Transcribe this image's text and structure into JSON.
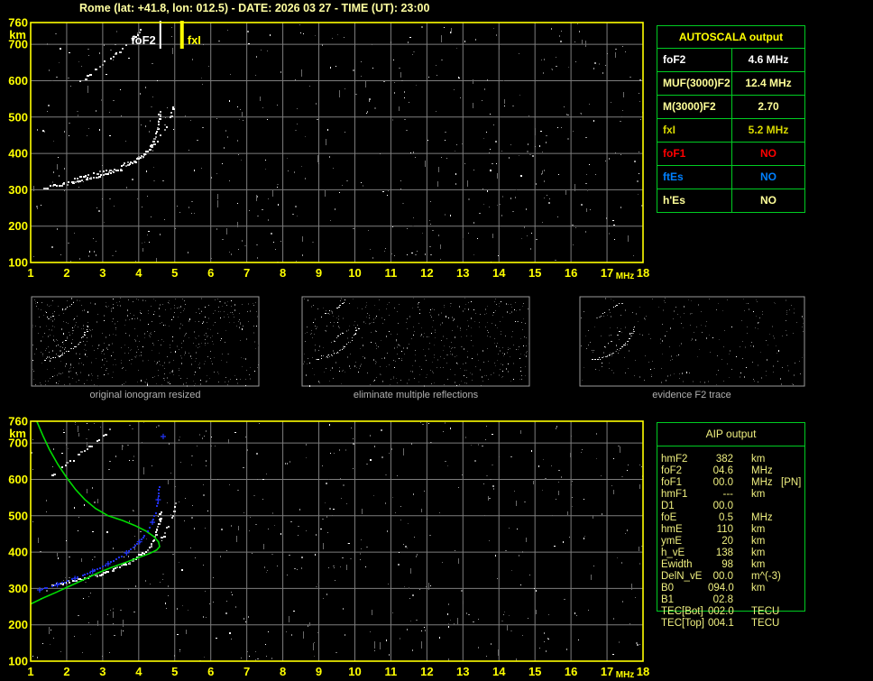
{
  "title": "Rome (lat: +41.8, lon: 012.5) - DATE: 2026 03 27 - TIME (UT): 23:00",
  "colors": {
    "accent_yellow": "#ffff00",
    "title_yellow": "#ffffa0",
    "pale_yellow": "#ffff99",
    "dark_yellow": "#d8d800",
    "white": "#ffffff",
    "red": "#ff0000",
    "blue": "#0080ff",
    "green_border": "#00cc22",
    "grid_gray": "#7d7d7d",
    "caption_gray": "#b0b0b0",
    "profile_green": "#00dd00",
    "trace_blue": "#2030e8"
  },
  "axes": {
    "x_range": [
      1,
      18
    ],
    "x_ticks": [
      1,
      2,
      3,
      4,
      5,
      6,
      7,
      8,
      9,
      10,
      11,
      12,
      13,
      14,
      15,
      16,
      17,
      18
    ],
    "x_unit": "MHz",
    "y_range": [
      100,
      760
    ],
    "y_ticks": [
      760,
      700,
      600,
      500,
      400,
      300,
      200,
      100
    ],
    "y_unit": "km",
    "grid": true
  },
  "chart_data": [
    {
      "type": "scatter",
      "name": "ionogram-autoscaled",
      "title": "",
      "xlabel": "MHz",
      "ylabel": "km",
      "xlim": [
        1,
        18
      ],
      "ylim": [
        100,
        760
      ],
      "legend": false,
      "markers": [
        {
          "label": "foF2",
          "x": 4.6,
          "color": "#ffffff",
          "width": 2,
          "side": "left"
        },
        {
          "label": "fxI",
          "x": 5.2,
          "color": "#ffff00",
          "width": 4,
          "side": "right"
        }
      ],
      "series": [
        {
          "name": "F2-trace-O-mode",
          "points": [
            [
              1.35,
              306
            ],
            [
              1.7,
              313
            ],
            [
              2.1,
              321
            ],
            [
              2.5,
              330
            ],
            [
              2.9,
              340
            ],
            [
              3.25,
              351
            ],
            [
              3.55,
              363
            ],
            [
              3.85,
              378
            ],
            [
              4.1,
              396
            ],
            [
              4.3,
              418
            ],
            [
              4.42,
              443
            ],
            [
              4.5,
              470
            ],
            [
              4.55,
              497
            ],
            [
              4.58,
              522
            ]
          ]
        },
        {
          "name": "F2-trace-X-mode",
          "points": [
            [
              2.2,
              334
            ],
            [
              2.6,
              342
            ],
            [
              3.0,
              352
            ],
            [
              3.4,
              364
            ],
            [
              3.75,
              378
            ],
            [
              4.05,
              394
            ],
            [
              4.3,
              413
            ],
            [
              4.5,
              436
            ],
            [
              4.68,
              463
            ],
            [
              4.82,
              492
            ],
            [
              4.92,
              520
            ],
            [
              4.97,
              538
            ]
          ]
        },
        {
          "name": "multiple-reflection-trace",
          "points": [
            [
              2.35,
              598
            ],
            [
              2.62,
              620
            ],
            [
              2.9,
              642
            ],
            [
              3.2,
              664
            ],
            [
              3.5,
              688
            ],
            [
              3.78,
              712
            ],
            [
              4.0,
              735
            ],
            [
              4.12,
              756
            ]
          ]
        }
      ]
    },
    {
      "type": "scatter",
      "name": "ionogram-with-restored-trace-and-profile",
      "title": "",
      "xlabel": "MHz",
      "ylabel": "km",
      "xlim": [
        1,
        18
      ],
      "ylim": [
        100,
        760
      ],
      "legend": false,
      "series": [
        {
          "name": "F2-trace-O-mode",
          "points": [
            [
              1.55,
              310
            ],
            [
              1.95,
              318
            ],
            [
              2.35,
              327
            ],
            [
              2.75,
              337
            ],
            [
              3.1,
              348
            ],
            [
              3.45,
              361
            ],
            [
              3.75,
              376
            ],
            [
              4.05,
              394
            ],
            [
              4.3,
              418
            ],
            [
              4.45,
              448
            ],
            [
              4.55,
              482
            ],
            [
              4.6,
              515
            ]
          ]
        },
        {
          "name": "F2-trace-X-mode",
          "points": [
            [
              4.6,
              436
            ],
            [
              4.75,
              460
            ],
            [
              4.88,
              490
            ],
            [
              4.97,
              520
            ],
            [
              5.02,
              545
            ]
          ]
        },
        {
          "name": "multiple-reflection-trace",
          "points": [
            [
              1.55,
              612
            ],
            [
              1.85,
              635
            ],
            [
              2.15,
              657
            ],
            [
              2.45,
              680
            ],
            [
              2.75,
              702
            ],
            [
              3.05,
              726
            ],
            [
              3.3,
              748
            ]
          ]
        },
        {
          "name": "restored-trace-blue",
          "points": [
            [
              1.25,
              296
            ],
            [
              1.6,
              306
            ],
            [
              1.95,
              317
            ],
            [
              2.3,
              330
            ],
            [
              2.65,
              344
            ],
            [
              3.0,
              360
            ],
            [
              3.3,
              376
            ],
            [
              3.6,
              393
            ],
            [
              3.85,
              412
            ],
            [
              4.08,
              434
            ],
            [
              4.25,
              458
            ],
            [
              4.38,
              482
            ],
            [
              4.47,
              508
            ],
            [
              4.53,
              535
            ],
            [
              4.56,
              562
            ],
            [
              4.58,
              588
            ]
          ],
          "isolated": [
            [
              4.68,
              718
            ]
          ]
        },
        {
          "name": "electron-density-profile-green",
          "points": [
            [
              1.0,
              257
            ],
            [
              1.35,
              274
            ],
            [
              1.7,
              289
            ],
            [
              2.05,
              305
            ],
            [
              2.45,
              323
            ],
            [
              2.85,
              342
            ],
            [
              3.25,
              358
            ],
            [
              3.65,
              372
            ],
            [
              4.0,
              385
            ],
            [
              4.3,
              396
            ],
            [
              4.5,
              406
            ],
            [
              4.58,
              415
            ],
            [
              4.55,
              428
            ],
            [
              4.42,
              443
            ],
            [
              4.2,
              458
            ],
            [
              3.9,
              473
            ],
            [
              3.55,
              487
            ],
            [
              3.15,
              500
            ],
            [
              2.8,
              520
            ],
            [
              2.5,
              545
            ],
            [
              2.25,
              572
            ],
            [
              2.0,
              605
            ],
            [
              1.75,
              642
            ],
            [
              1.52,
              682
            ],
            [
              1.35,
              718
            ],
            [
              1.22,
              748
            ],
            [
              1.17,
              760
            ]
          ]
        }
      ]
    }
  ],
  "thumbnails": [
    {
      "caption": "original ionogram resized"
    },
    {
      "caption": "eliminate multiple reflections"
    },
    {
      "caption": "evidence F2 trace"
    }
  ],
  "autoscala": {
    "title": "AUTOSCALA output",
    "rows": [
      {
        "label": "foF2",
        "value": "4.6 MHz",
        "color": "#ffffff"
      },
      {
        "label": "MUF(3000)F2",
        "value": "12.4 MHz",
        "color": "#ffff99"
      },
      {
        "label": "M(3000)F2",
        "value": "2.70",
        "color": "#ffff99"
      },
      {
        "label": "fxI",
        "value": "5.2 MHz",
        "color": "#d8d800"
      },
      {
        "label": "foF1",
        "value": "NO",
        "color": "#ff0000"
      },
      {
        "label": "ftEs",
        "value": "NO",
        "color": "#0080ff"
      },
      {
        "label": "h'Es",
        "value": "NO",
        "color": "#ffff99"
      }
    ]
  },
  "aip": {
    "title": "AIP output",
    "rows": [
      {
        "label": "hmF2",
        "value": "382",
        "unit": "km",
        "note": ""
      },
      {
        "label": "foF2",
        "value": "04.6",
        "unit": "MHz",
        "note": ""
      },
      {
        "label": "foF1",
        "value": "00.0",
        "unit": "MHz",
        "note": "[PN]"
      },
      {
        "label": "hmF1",
        "value": "---",
        "unit": "km",
        "note": ""
      },
      {
        "label": "D1",
        "value": "00.0",
        "unit": "",
        "note": ""
      },
      {
        "label": "foE",
        "value": "0.5",
        "unit": "MHz",
        "note": ""
      },
      {
        "label": "hmE",
        "value": "110",
        "unit": "km",
        "note": ""
      },
      {
        "label": "ymE",
        "value": "20",
        "unit": "km",
        "note": ""
      },
      {
        "label": "h_vE",
        "value": "138",
        "unit": "km",
        "note": ""
      },
      {
        "label": "Ewidth",
        "value": "98",
        "unit": "km",
        "note": ""
      },
      {
        "label": "DelN_vE",
        "value": "00.0",
        "unit": "m^(-3)",
        "note": ""
      },
      {
        "label": "B0",
        "value": "094.0",
        "unit": "km",
        "note": ""
      },
      {
        "label": "B1",
        "value": "02.8",
        "unit": "",
        "note": ""
      },
      {
        "label": "TEC[Bot]",
        "value": "002.0",
        "unit": "TECU",
        "note": ""
      },
      {
        "label": "TEC[Top]",
        "value": "004.1",
        "unit": "TECU",
        "note": ""
      }
    ]
  }
}
